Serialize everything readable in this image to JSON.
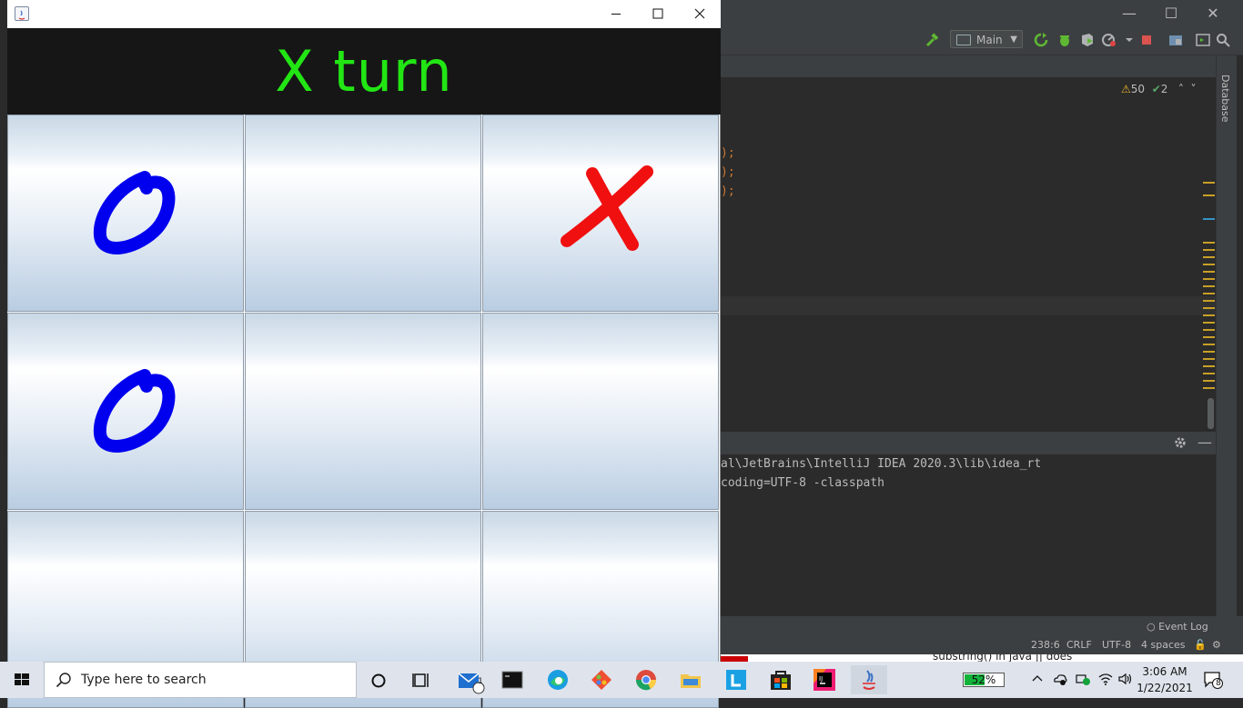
{
  "ide": {
    "run_config": "Main",
    "inspections": {
      "warnings": "50",
      "weak_warnings": "2"
    },
    "side_panel": "Database",
    "code_fragments": [
      ");",
      ");",
      ");"
    ],
    "console_lines": [
      "al\\JetBrains\\IntelliJ IDEA 2020.3\\lib\\idea_rt",
      "coding=UTF-8 -classpath"
    ],
    "event_log": "Event Log",
    "status": {
      "position": "238:6",
      "line_sep": "CRLF",
      "encoding": "UTF-8",
      "indent": "4 spaces"
    },
    "browser_strip_text": "substring() in java || does"
  },
  "game": {
    "turn_label": "X turn",
    "board": [
      "O",
      "",
      "X",
      "O",
      "",
      "",
      "",
      "",
      ""
    ],
    "colors": {
      "banner_bg": "#161616",
      "turn_text": "#22e614",
      "o_mark": "#0000ee",
      "x_mark": "#f01010"
    }
  },
  "taskbar": {
    "search_placeholder": "Type here to search",
    "mail_badge": "1",
    "battery": "52%",
    "battery_level": 0.52,
    "time": "3:06 AM",
    "date": "1/22/2021",
    "notifications": "8",
    "apps": [
      "task-view-icon",
      "mail-icon",
      "terminal-icon",
      "edge-icon",
      "git-icon",
      "chrome-icon",
      "file-explorer-icon",
      "l-app-icon",
      "store-icon",
      "intellij-icon",
      "java-icon"
    ]
  }
}
